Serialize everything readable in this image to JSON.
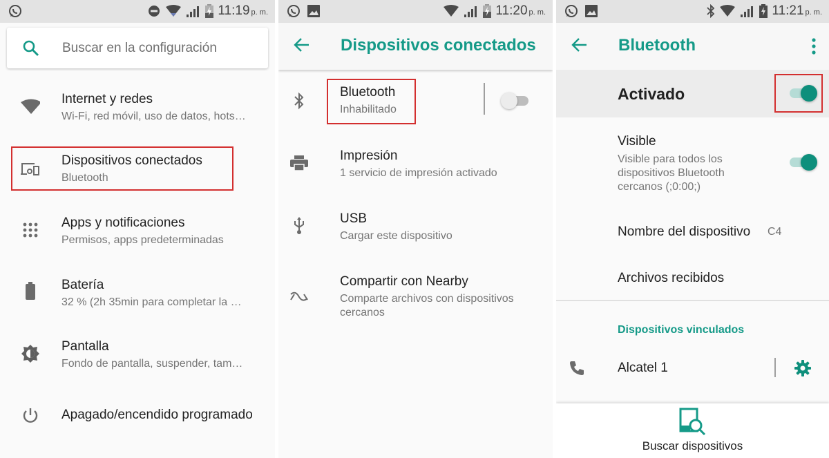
{
  "screens": [
    {
      "status": {
        "time": "11:19",
        "ampm": "p. m.",
        "left_icons": [
          "whatsapp-icon"
        ],
        "right_icons": [
          "do-not-disturb-icon",
          "wifi-icon",
          "signal-icon",
          "battery-charging-icon"
        ]
      },
      "search": {
        "placeholder": "Buscar en la configuración",
        "icon": "search-icon"
      },
      "items": [
        {
          "icon": "wifi-icon",
          "title": "Internet y redes",
          "subtitle": "Wi-Fi, red móvil, uso de datos, hots…"
        },
        {
          "icon": "devices-icon",
          "title": "Dispositivos conectados",
          "subtitle": "Bluetooth",
          "highlighted": true
        },
        {
          "icon": "apps-grid-icon",
          "title": "Apps y notificaciones",
          "subtitle": "Permisos, apps predeterminadas"
        },
        {
          "icon": "battery-icon",
          "title": "Batería",
          "subtitle": "32 % (2h 35min para completar la …"
        },
        {
          "icon": "brightness-icon",
          "title": "Pantalla",
          "subtitle": "Fondo de pantalla, suspender, tam…"
        },
        {
          "icon": "power-icon",
          "title": "Apagado/encendido programado",
          "subtitle": ""
        }
      ]
    },
    {
      "status": {
        "time": "11:20",
        "ampm": "p. m.",
        "left_icons": [
          "whatsapp-icon",
          "image-icon"
        ],
        "right_icons": [
          "wifi-icon",
          "signal-icon",
          "battery-charging-icon"
        ]
      },
      "toolbar": {
        "title": "Dispositivos conectados",
        "back_icon": "arrow-back-icon"
      },
      "items": [
        {
          "icon": "bluetooth-icon",
          "title": "Bluetooth",
          "subtitle": "Inhabilitado",
          "highlighted": true,
          "toggle": false
        },
        {
          "icon": "print-icon",
          "title": "Impresión",
          "subtitle": "1 servicio de impresión activado"
        },
        {
          "icon": "usb-icon",
          "title": "USB",
          "subtitle": "Cargar este dispositivo"
        },
        {
          "icon": "nearby-icon",
          "title": "Compartir con Nearby",
          "subtitle": "Comparte archivos con dispositivos",
          "subtitle2": "cercanos"
        }
      ]
    },
    {
      "status": {
        "time": "11:21",
        "ampm": "p. m.",
        "left_icons": [
          "whatsapp-icon",
          "image-icon"
        ],
        "right_icons": [
          "bluetooth-icon",
          "wifi-icon",
          "signal-icon",
          "battery-charging-icon"
        ]
      },
      "toolbar": {
        "title": "Bluetooth",
        "back_icon": "arrow-back-icon",
        "menu_icon": "more-vert-icon"
      },
      "master": {
        "label": "Activado",
        "toggle": true
      },
      "visible": {
        "title": "Visible",
        "subtitle_lines": [
          "Visible para todos los",
          "dispositivos Bluetooth",
          "cercanos (;0:00;)"
        ],
        "toggle": true
      },
      "device_name": {
        "title": "Nombre del dispositivo",
        "value": "C4"
      },
      "received": {
        "title": "Archivos recibidos"
      },
      "paired_header": "Dispositivos vinculados",
      "paired": [
        {
          "icon": "phone-icon",
          "name": "Alcatel 1",
          "settings_icon": "gear-icon"
        }
      ],
      "bottom_action": {
        "label": "Buscar dispositivos",
        "icon": "device-search-icon"
      }
    }
  ],
  "colors": {
    "accent": "#159a88",
    "toggle_on": "#0e8f7c",
    "highlight_box": "#d32f2f",
    "statusbar": "#e3e3e3"
  }
}
